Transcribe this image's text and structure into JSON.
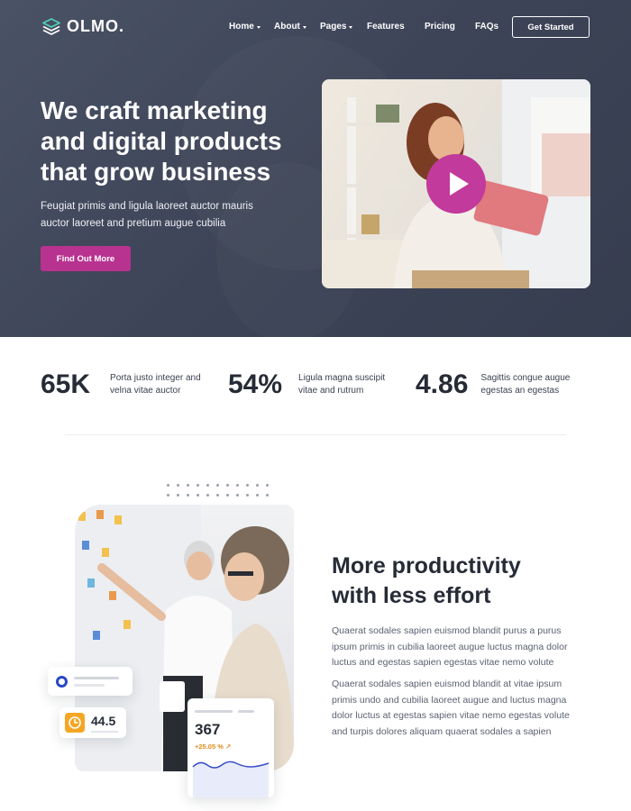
{
  "brand": {
    "name": "OLMO.",
    "accent": "#b8338f",
    "hero_bg": "#3d4457"
  },
  "nav": {
    "items": [
      {
        "label": "Home",
        "dropdown": true
      },
      {
        "label": "About",
        "dropdown": true
      },
      {
        "label": "Pages",
        "dropdown": true
      },
      {
        "label": "Features",
        "dropdown": false
      },
      {
        "label": "Pricing",
        "dropdown": false
      },
      {
        "label": "FAQs",
        "dropdown": false
      }
    ],
    "cta": "Get Started"
  },
  "hero": {
    "title_lines": [
      "We craft marketing",
      "and digital products",
      "that grow business"
    ],
    "subtitle_lines": [
      "Feugiat primis and ligula laoreet auctor mauris",
      "auctor laoreet and pretium augue cubilia"
    ],
    "button": "Find Out More",
    "video_icon": "play-icon"
  },
  "stats": [
    {
      "value": "65K",
      "desc_lines": [
        "Porta justo integer and",
        "velna vitae auctor"
      ]
    },
    {
      "value": "54%",
      "desc_lines": [
        "Ligula magna suscipit",
        "vitae and rutrum"
      ]
    },
    {
      "value": "4.86",
      "desc_lines": [
        "Sagittis congue augue",
        "egestas an egestas"
      ]
    }
  ],
  "feature": {
    "title_lines": [
      "More productivity",
      "with less effort"
    ],
    "para1_lines": [
      "Quaerat sodales sapien euismod blandit purus a purus",
      "ipsum primis in cubilia laoreet augue luctus magna dolor",
      "luctus and egestas sapien egestas vitae nemo volute"
    ],
    "para2_lines": [
      "Quaerat sodales sapien euismod blandit at vitae ipsum",
      "primis undo and cubilia laoreet augue and luctus magna",
      "dolor luctus at egestas sapien vitae nemo egestas volute",
      "and turpis dolores aliquam quaerat sodales a sapien"
    ],
    "cards": {
      "timer_value": "44.5",
      "stat_value": "367",
      "stat_change": "+25.05 %"
    }
  }
}
